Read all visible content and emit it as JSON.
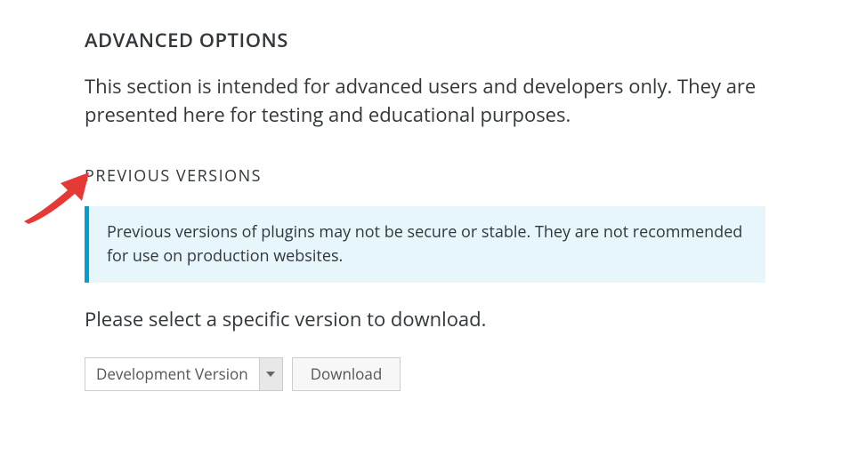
{
  "advanced": {
    "heading": "ADVANCED OPTIONS",
    "intro": "This section is intended for advanced users and developers only. They are presented here for testing and educational purposes."
  },
  "previous": {
    "heading": "PREVIOUS VERSIONS",
    "notice": "Previous versions of plugins may not be secure or stable. They are not recommended for use on production websites.",
    "instruction": "Please select a specific version to download.",
    "select_value": "Development Version",
    "download_label": "Download"
  }
}
